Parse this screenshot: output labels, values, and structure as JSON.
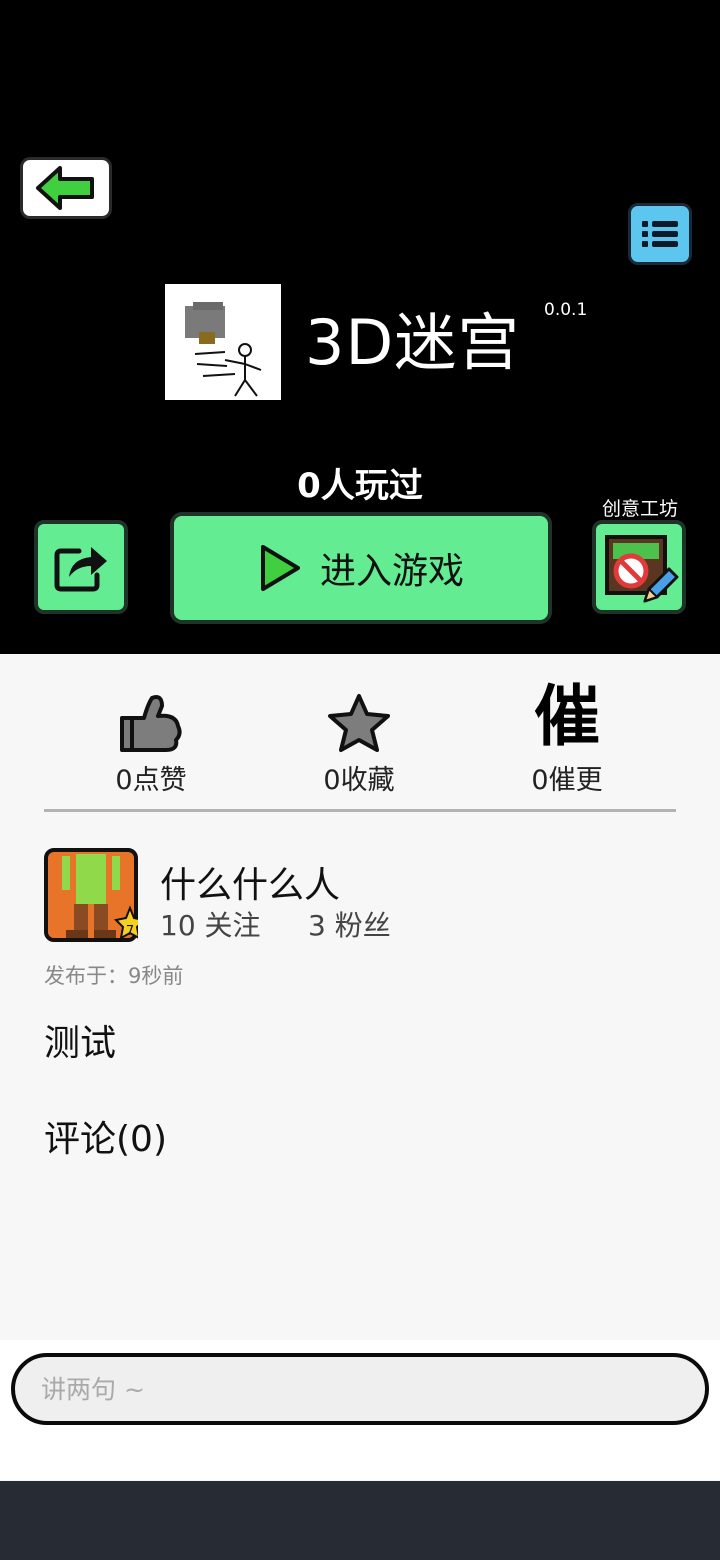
{
  "header": {
    "game_title": "3D迷宫",
    "version": "0.0.1",
    "play_count": "0人玩过",
    "enter_button": "进入游戏",
    "workshop_label": "创意工坊"
  },
  "stats": {
    "likes": "0点赞",
    "favorites": "0收藏",
    "urge_icon_char": "催",
    "urges": "0催更"
  },
  "author": {
    "name": "什么什么人",
    "level": "7",
    "following": "10 关注",
    "followers": "3 粉丝"
  },
  "post": {
    "published": "发布于：9秒前",
    "content": "测试",
    "comments": "评论(0)"
  },
  "comment_input": {
    "placeholder": "讲两句 ~"
  },
  "colors": {
    "accent_green": "#64ec93",
    "menu_blue": "#5cc6ee",
    "header_bg": "#000000"
  }
}
